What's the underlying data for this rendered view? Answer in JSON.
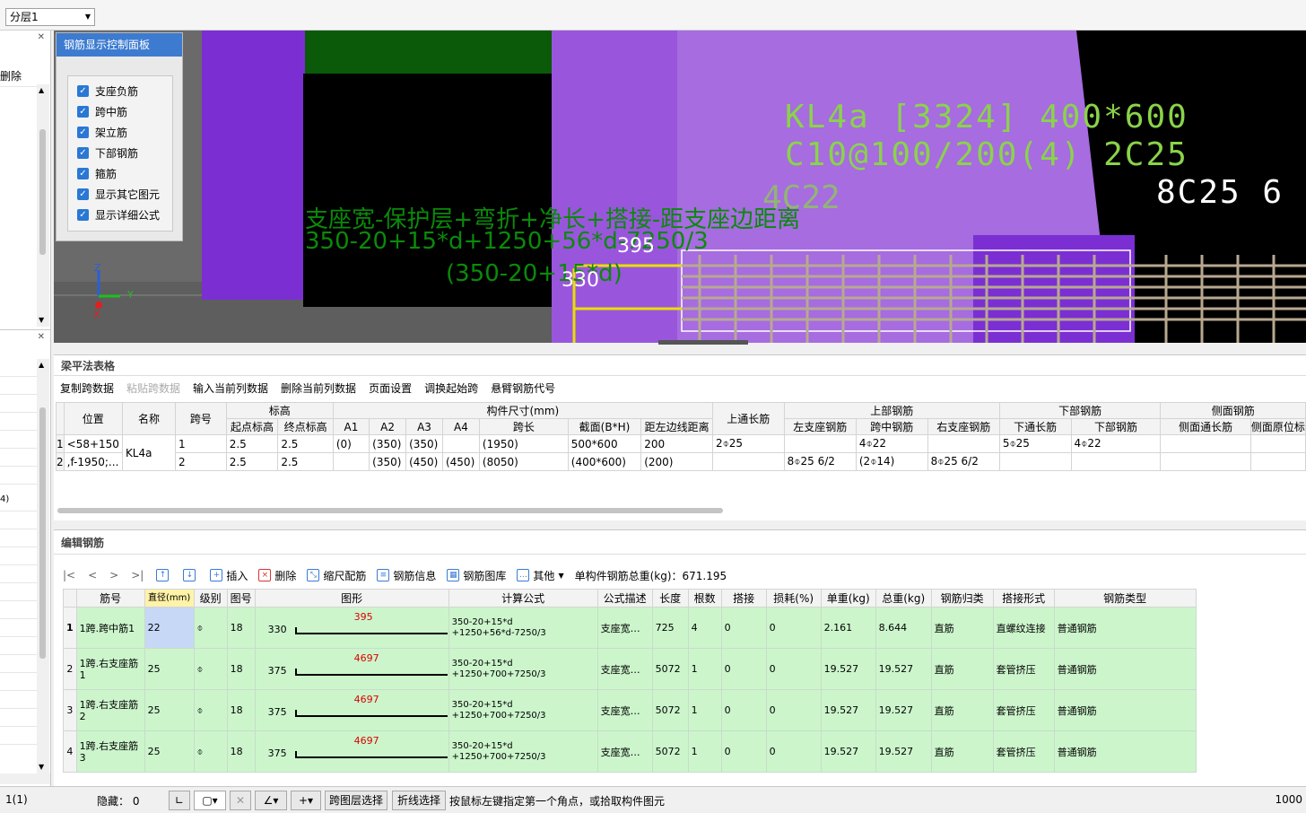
{
  "top": {
    "layer_value": "分层1"
  },
  "left_panel": {
    "delete_label": "删除",
    "partial_label": "4)"
  },
  "control_panel": {
    "title": "钢筋显示控制面板",
    "items": [
      "支座负筋",
      "跨中筋",
      "架立筋",
      "下部钢筋",
      "箍筋",
      "显示其它图元",
      "显示详细公式"
    ]
  },
  "viewport": {
    "colors": {
      "purple": "#7b2fd3",
      "light_purple": "#a66ce0",
      "black": "#000000",
      "green": "#0a6a0a"
    },
    "beam_label": [
      "KL4a [3324] 400*600",
      "C10@100/200(4) 2C25",
      "8C25 6"
    ],
    "beam_label_extra": "4C22",
    "formula_cn": "支座宽-保护层+弯折+净长+搭接-距支座边距离",
    "formula_num": "350-20+15*d+1250+56*d-7250/3",
    "formula_sub": "(350-20+15*d)",
    "dim1": "395",
    "dim2": "330",
    "axis": {
      "z": "Z",
      "y": "Y",
      "x": "X"
    }
  },
  "beam_table": {
    "title": "梁平法表格",
    "toolbar": [
      "复制跨数据",
      "粘贴跨数据",
      "输入当前列数据",
      "删除当前列数据",
      "页面设置",
      "调换起始跨",
      "悬臂钢筋代号"
    ],
    "group_headers": [
      "标高",
      "构件尺寸(mm)",
      "上部钢筋",
      "下部钢筋",
      "侧面钢筋"
    ],
    "headers": [
      "位置",
      "名称",
      "跨号",
      "起点标高",
      "终点标高",
      "A1",
      "A2",
      "A3",
      "A4",
      "跨长",
      "截面(B*H)",
      "距左边线距离",
      "上通长筋",
      "左支座钢筋",
      "跨中钢筋",
      "右支座钢筋",
      "下通长筋",
      "下部钢筋",
      "侧面通长筋",
      "侧面原位标"
    ],
    "rows": [
      [
        "1",
        "<58+150",
        "KL4a",
        "1",
        "2.5",
        "2.5",
        "(0)",
        "(350)",
        "(350)",
        "",
        "(1950)",
        "500*600",
        "200",
        "2⌽25",
        "",
        "4⌽22",
        "",
        "5⌽25",
        "4⌽22",
        "",
        ""
      ],
      [
        "2",
        ",f-1950;...",
        "",
        "2",
        "2.5",
        "2.5",
        "",
        "(350)",
        "(450)",
        "(450)",
        "(8050)",
        "(400*600)",
        "(200)",
        "",
        "8⌽25 6/2",
        "(2⌽14)",
        "8⌽25 6/2",
        "",
        "",
        "",
        ""
      ]
    ]
  },
  "rebar_edit": {
    "title": "编辑钢筋",
    "nav": [
      "|<",
      "<",
      ">",
      ">|"
    ],
    "toolbar": [
      "插入",
      "删除",
      "缩尺配筋",
      "钢筋信息",
      "钢筋图库",
      "其他"
    ],
    "total_weight": "单构件钢筋总重(kg)：671.195",
    "headers": [
      "筋号",
      "直径(mm)",
      "级别",
      "图号",
      "图形",
      "计算公式",
      "公式描述",
      "长度",
      "根数",
      "搭接",
      "损耗(%)",
      "单重(kg)",
      "总重(kg)",
      "钢筋归类",
      "搭接形式",
      "钢筋类型"
    ],
    "rows": [
      {
        "n": "1",
        "name": "1跨.跨中筋1",
        "dia": "22",
        "grade": "⌽",
        "fig": "18",
        "left": "330",
        "top": "395",
        "f1": "350-20+15*d",
        "f2": "+1250+56*d-7250/3",
        "desc": "支座宽…",
        "len": "725",
        "cnt": "4",
        "lap": "0",
        "loss": "0",
        "uw": "2.161",
        "tw": "8.644",
        "cls": "直筋",
        "lapf": "直螺纹连接",
        "type": "普通钢筋"
      },
      {
        "n": "2",
        "name": "1跨.右支座筋1",
        "dia": "25",
        "grade": "⌽",
        "fig": "18",
        "left": "375",
        "top": "4697",
        "f1": "350-20+15*d",
        "f2": "+1250+700+7250/3",
        "desc": "支座宽…",
        "len": "5072",
        "cnt": "1",
        "lap": "0",
        "loss": "0",
        "uw": "19.527",
        "tw": "19.527",
        "cls": "直筋",
        "lapf": "套管挤压",
        "type": "普通钢筋"
      },
      {
        "n": "3",
        "name": "1跨.右支座筋2",
        "dia": "25",
        "grade": "⌽",
        "fig": "18",
        "left": "375",
        "top": "4697",
        "f1": "350-20+15*d",
        "f2": "+1250+700+7250/3",
        "desc": "支座宽…",
        "len": "5072",
        "cnt": "1",
        "lap": "0",
        "loss": "0",
        "uw": "19.527",
        "tw": "19.527",
        "cls": "直筋",
        "lapf": "套管挤压",
        "type": "普通钢筋"
      },
      {
        "n": "4",
        "name": "1跨.右支座筋3",
        "dia": "25",
        "grade": "⌽",
        "fig": "18",
        "left": "375",
        "top": "4697",
        "f1": "350-20+15*d",
        "f2": "+1250+700+7250/3",
        "desc": "支座宽…",
        "len": "5072",
        "cnt": "1",
        "lap": "0",
        "loss": "0",
        "uw": "19.527",
        "tw": "19.527",
        "cls": "直筋",
        "lapf": "套管挤压",
        "type": "普通钢筋"
      }
    ]
  },
  "status": {
    "left": "1(1)",
    "hidden": "隐藏： 0",
    "btn_cross_layer": "跨图层选择",
    "btn_polyline": "折线选择",
    "hint": "按鼠标左键指定第一个角点，或拾取构件图元",
    "right": "1000"
  }
}
